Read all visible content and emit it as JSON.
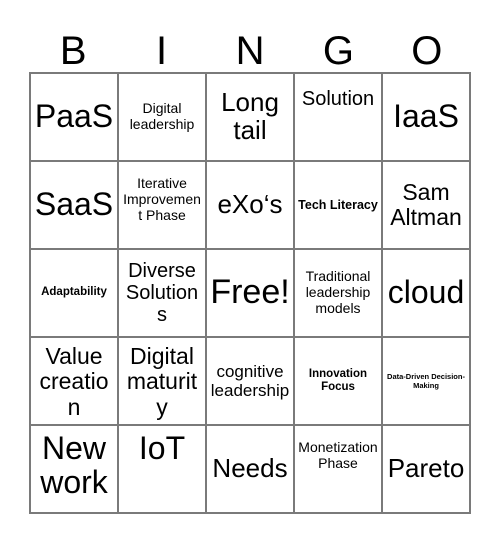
{
  "card": {
    "title": "BINGO",
    "header_letters": [
      "B",
      "I",
      "N",
      "G",
      "O"
    ],
    "grid_size": "5x5",
    "free_space": "Free!",
    "colors": {
      "text": "#000000",
      "grid_line": "#7a7a7a",
      "background": "#ffffff"
    },
    "cells": [
      {
        "text": "PaaS",
        "size": "s-xl",
        "align": "v-center"
      },
      {
        "text": "Digital leadership",
        "size": "s-xxs",
        "align": "v-center"
      },
      {
        "text": "Long tail",
        "size": "s-lg",
        "align": "v-center"
      },
      {
        "text": "Solution",
        "size": "s-sm",
        "align": "v-upper"
      },
      {
        "text": "IaaS",
        "size": "s-xl",
        "align": "v-center"
      },
      {
        "text": "SaaS",
        "size": "s-xl",
        "align": "v-center"
      },
      {
        "text": "Iterative Improvement Phase",
        "size": "s-xxs",
        "align": "v-upper"
      },
      {
        "text": "eXo‘s",
        "size": "s-lg",
        "align": "v-center"
      },
      {
        "text": "Tech Literacy",
        "size": "s-b12",
        "align": "v-center"
      },
      {
        "text": "Sam Altman",
        "size": "s-md",
        "align": "v-center"
      },
      {
        "text": "Adaptability",
        "size": "s-b11",
        "align": "v-center"
      },
      {
        "text": "Diverse Solutions",
        "size": "s-sm",
        "align": "v-center"
      },
      {
        "text": "Free!",
        "size": "s-xxl",
        "align": "v-center"
      },
      {
        "text": "Traditional leadership models",
        "size": "s-xxs",
        "align": "v-center"
      },
      {
        "text": "cloud",
        "size": "s-xl",
        "align": "v-center"
      },
      {
        "text": "Value creation",
        "size": "s-md",
        "align": "v-top"
      },
      {
        "text": "Digital maturity",
        "size": "s-md",
        "align": "v-top"
      },
      {
        "text": "cognitive leadership",
        "size": "s-xs",
        "align": "v-center"
      },
      {
        "text": "Innovation Focus",
        "size": "s-b11",
        "align": "v-center"
      },
      {
        "text": "Data-Driven Decision-Making",
        "size": "s-b7",
        "align": "v-center"
      },
      {
        "text": "New work",
        "size": "s-xl",
        "align": "v-top"
      },
      {
        "text": "IoT",
        "size": "s-xl",
        "align": "v-top"
      },
      {
        "text": "Needs",
        "size": "s-lg",
        "align": "v-center"
      },
      {
        "text": "Monetization Phase",
        "size": "s-xxs",
        "align": "v-upper"
      },
      {
        "text": "Pareto",
        "size": "s-lg",
        "align": "v-center"
      }
    ]
  }
}
